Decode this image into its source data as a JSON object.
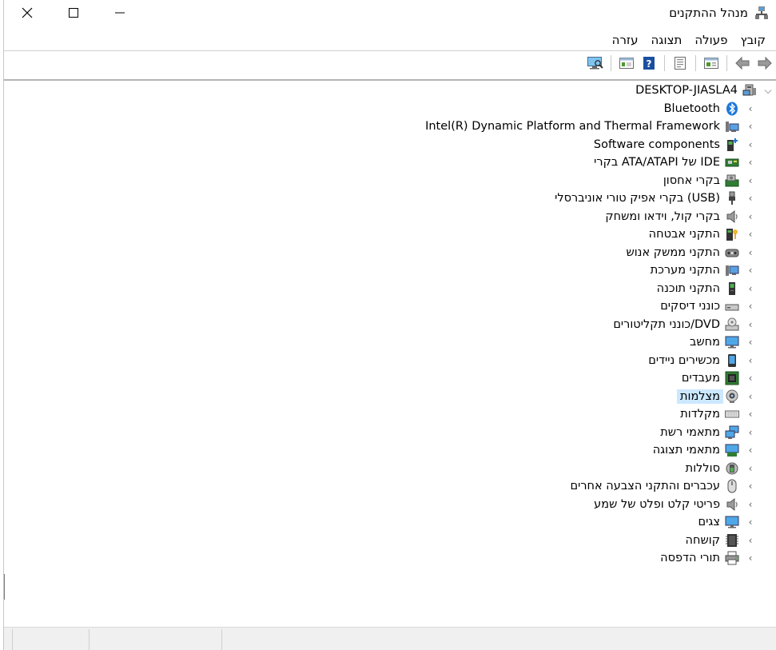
{
  "window": {
    "title": "מנהל ההתקנים",
    "title_icon": "device-manager-icon"
  },
  "menu": [
    {
      "label": "קובץ"
    },
    {
      "label": "פעולה"
    },
    {
      "label": "תצוגה"
    },
    {
      "label": "עזרה"
    }
  ],
  "toolbar": [
    {
      "name": "back-icon"
    },
    {
      "name": "forward-icon"
    },
    {
      "name": "show-hide-console-tree-icon"
    },
    {
      "name": "properties-icon"
    },
    {
      "name": "help-icon"
    },
    {
      "name": "view-pane-icon"
    },
    {
      "name": "scan-hardware-icon"
    }
  ],
  "tree": {
    "root": {
      "label": "DESKTOP-JIASLA4",
      "icon": "computer-icon",
      "expanded": true
    },
    "items": [
      {
        "label": "Bluetooth",
        "icon": "bluetooth-icon"
      },
      {
        "label": "Intel(R) Dynamic Platform and Thermal Framework",
        "icon": "thermal-framework-icon"
      },
      {
        "label": "Software components",
        "icon": "software-components-icon"
      },
      {
        "label": "בקרי ATA/ATAPI של IDE",
        "icon": "ide-controller-icon"
      },
      {
        "label": "בקרי אחסון",
        "icon": "storage-controller-icon"
      },
      {
        "label": "בקרי אפיק טורי אוניברסלי (USB)",
        "icon": "usb-icon"
      },
      {
        "label": "בקרי קול, וידאו ומשחק",
        "icon": "audio-icon"
      },
      {
        "label": "התקני אבטחה",
        "icon": "security-device-icon"
      },
      {
        "label": "התקני ממשק אנוש",
        "icon": "hid-icon"
      },
      {
        "label": "התקני מערכת",
        "icon": "system-devices-icon"
      },
      {
        "label": "התקני תוכנה",
        "icon": "software-devices-icon"
      },
      {
        "label": "כונני דיסקים",
        "icon": "disk-drive-icon"
      },
      {
        "label": "כונני תקליטורים/DVD",
        "icon": "dvd-drive-icon"
      },
      {
        "label": "מחשב",
        "icon": "monitor-icon"
      },
      {
        "label": "מכשירים ניידים",
        "icon": "portable-device-icon"
      },
      {
        "label": "מעבדים",
        "icon": "processor-icon"
      },
      {
        "label": "מצלמות",
        "icon": "camera-icon",
        "selected": true
      },
      {
        "label": "מקלדות",
        "icon": "keyboard-icon"
      },
      {
        "label": "מתאמי רשת",
        "icon": "network-adapter-icon"
      },
      {
        "label": "מתאמי תצוגה",
        "icon": "display-adapter-icon"
      },
      {
        "label": "סוללות",
        "icon": "battery-icon"
      },
      {
        "label": "עכברים והתקני הצבעה אחרים",
        "icon": "mouse-icon"
      },
      {
        "label": "פריטי קלט ופלט של שמע",
        "icon": "audio-io-icon"
      },
      {
        "label": "צגים",
        "icon": "monitor-icon"
      },
      {
        "label": "קושחה",
        "icon": "firmware-icon"
      },
      {
        "label": "תורי הדפסה",
        "icon": "printer-icon"
      }
    ]
  },
  "colors": {
    "selection": "#cce8ff",
    "accent_blue": "#1e78d7"
  }
}
